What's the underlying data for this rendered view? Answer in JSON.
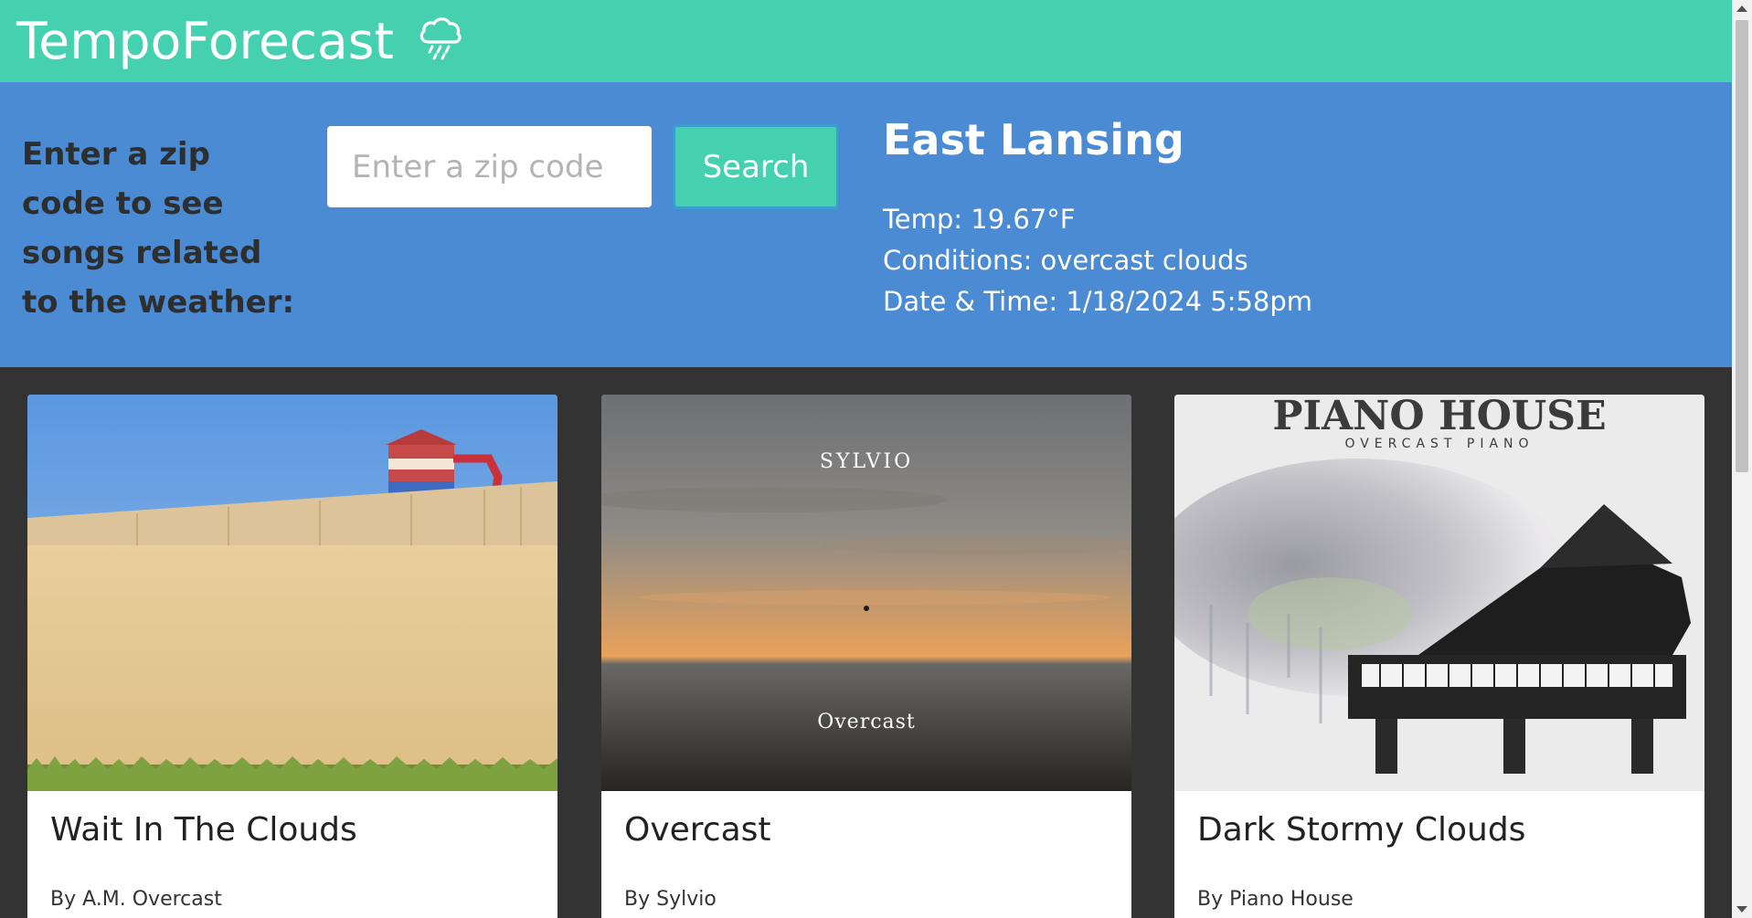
{
  "app": {
    "brand": "TempoForecast",
    "brand_icon": "cloud-rain-icon"
  },
  "search": {
    "prompt": "Enter a zip code to see songs related to the weather:",
    "placeholder": "Enter a zip code",
    "value": "",
    "button_label": "Search"
  },
  "weather": {
    "city": "East Lansing",
    "temp": "Temp: 19.67°F",
    "conditions": "Conditions: overcast clouds",
    "datetime": "Date & Time: 1/18/2024 5:58pm"
  },
  "songs": [
    {
      "title": "Wait In The Clouds",
      "artist": "By  A.M. Overcast",
      "art_text": []
    },
    {
      "title": "Overcast",
      "artist": "By  Sylvio",
      "art_text": [
        "SYLVIO",
        "Overcast"
      ]
    },
    {
      "title": "Dark Stormy Clouds",
      "artist": "By  Piano House",
      "art_text": [
        "PIANO HOUSE",
        "OVERCAST PIANO"
      ]
    }
  ],
  "colors": {
    "header": "#45d0b0",
    "weather_band": "#4a8bd3",
    "background": "#333333",
    "accent": "#45d0b0"
  }
}
